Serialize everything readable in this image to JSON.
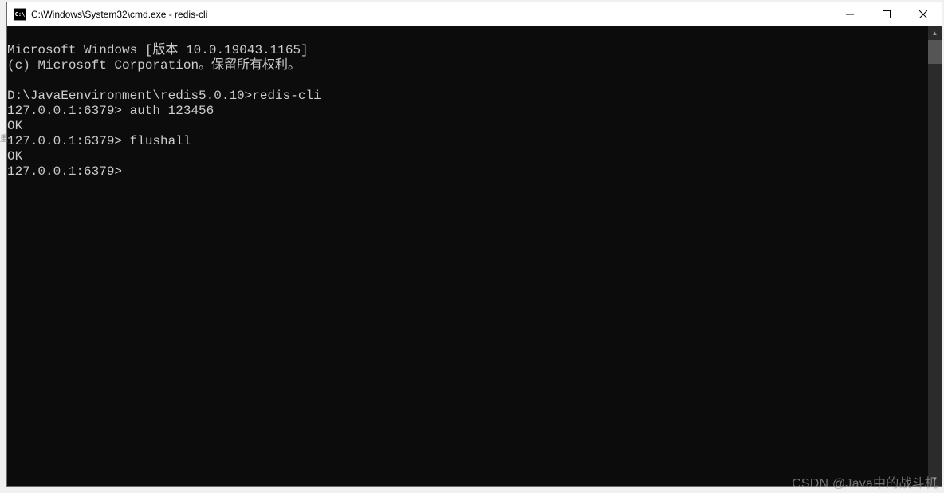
{
  "window": {
    "title": "C:\\Windows\\System32\\cmd.exe - redis-cli",
    "icon_label": "C:\\"
  },
  "terminal": {
    "lines": [
      "Microsoft Windows [版本 10.0.19043.1165]",
      "(c) Microsoft Corporation。保留所有权利。",
      "",
      "D:\\JavaEenvironment\\redis5.0.10>redis-cli",
      "127.0.0.1:6379> auth 123456",
      "OK",
      "127.0.0.1:6379> flushall",
      "OK",
      "127.0.0.1:6379>"
    ]
  },
  "watermark": "CSDN @Java中的战斗机",
  "edge_noise": "重"
}
